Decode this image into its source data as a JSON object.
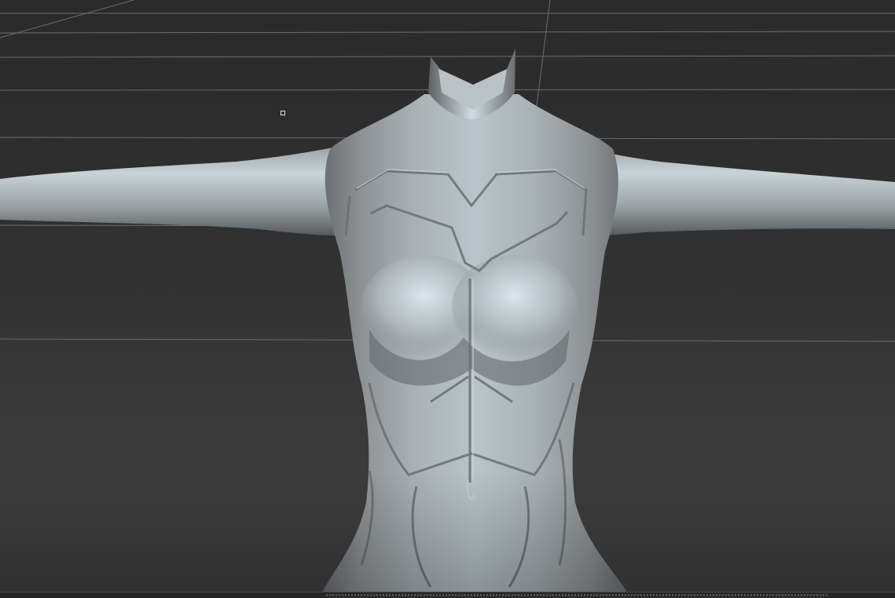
{
  "app": {
    "view": "3d-sculpt-viewport"
  },
  "viewport": {
    "background_top": "#2a2a2a",
    "background_bottom": "#414141",
    "grid_color": "#6d6d6d",
    "model": {
      "name": "",
      "material_color": "#9a9ea1",
      "highlight_color": "#d6e4ea",
      "shadow_color": "#4a4c4e"
    },
    "cursor_icon": "vertex-marker-icon"
  },
  "status_bar": {
    "grip_icon": "resize-grip-icon"
  }
}
